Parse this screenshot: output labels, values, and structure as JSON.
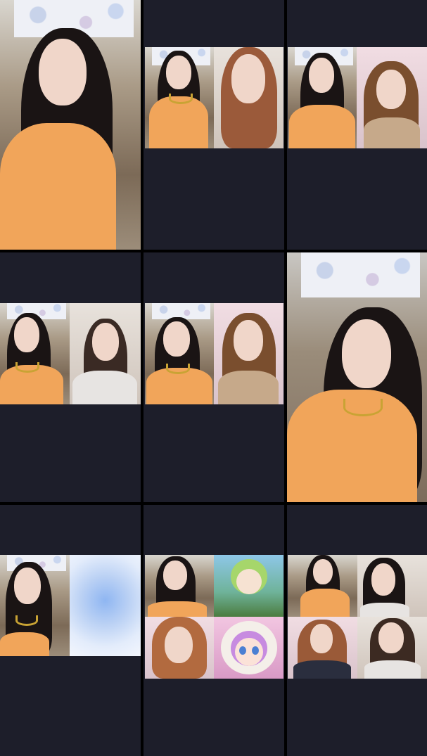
{
  "grid": {
    "cells": [
      {
        "layout": "single",
        "streams": [
          "host"
        ]
      },
      {
        "layout": "duo",
        "streams": [
          "host",
          "guest-auburn"
        ]
      },
      {
        "layout": "duo",
        "streams": [
          "host",
          "guest-beige"
        ]
      },
      {
        "layout": "duo",
        "streams": [
          "host",
          "guest-white"
        ]
      },
      {
        "layout": "duo",
        "streams": [
          "host",
          "guest-beige"
        ]
      },
      {
        "layout": "single",
        "streams": [
          "host"
        ]
      },
      {
        "layout": "duo",
        "streams": [
          "host",
          "blurred-stream"
        ]
      },
      {
        "layout": "quad",
        "streams": [
          "host",
          "cartoon-green",
          "guest-auburn",
          "cartoon-pink"
        ]
      },
      {
        "layout": "quad",
        "streams": [
          "host",
          "guest-navy",
          "guest-auburn",
          "guest-white"
        ]
      }
    ]
  },
  "colors": {
    "panel_background": "#1d1e2a",
    "divider": "#000000",
    "host_shirt": "#f1a55a",
    "hair": "#1a1414",
    "necklace": "#c9a334"
  }
}
